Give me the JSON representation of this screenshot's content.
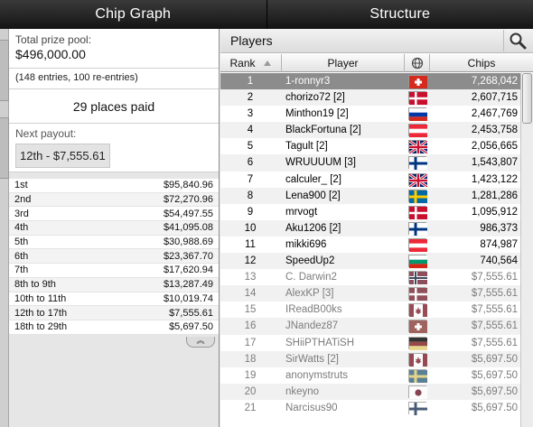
{
  "tabs": [
    "Chip Graph",
    "Structure"
  ],
  "prize": {
    "label": "Total prize pool:",
    "value": "$496,000.00",
    "entries": "(148 entries, 100 re-entries)",
    "places_paid": "29 places paid"
  },
  "next_payout": {
    "label": "Next payout:",
    "value": "12th - $7,555.61"
  },
  "payouts": [
    {
      "place": "1st",
      "amount": "$95,840.96"
    },
    {
      "place": "2nd",
      "amount": "$72,270.96"
    },
    {
      "place": "3rd",
      "amount": "$54,497.55"
    },
    {
      "place": "4th",
      "amount": "$41,095.08"
    },
    {
      "place": "5th",
      "amount": "$30,988.69"
    },
    {
      "place": "6th",
      "amount": "$23,367.70"
    },
    {
      "place": "7th",
      "amount": "$17,620.94"
    },
    {
      "place": "8th to 9th",
      "amount": "$13,287.49"
    },
    {
      "place": "10th to 11th",
      "amount": "$10,019.74"
    },
    {
      "place": "12th to 17th",
      "amount": "$7,555.61"
    },
    {
      "place": "18th to 29th",
      "amount": "$5,697.50"
    }
  ],
  "collapse_glyph": "︽",
  "players": {
    "title": "Players",
    "columns": {
      "rank": "Rank",
      "player": "Player",
      "chips": "Chips"
    },
    "rows": [
      {
        "rank": "1",
        "name": "1-ronnyr3",
        "flag": "ch",
        "chips": "7,268,042"
      },
      {
        "rank": "2",
        "name": "chorizo72 [2]",
        "flag": "dk",
        "chips": "2,607,715"
      },
      {
        "rank": "3",
        "name": "Minthon19 [2]",
        "flag": "ru",
        "chips": "2,467,769"
      },
      {
        "rank": "4",
        "name": "BlackFortuna [2]",
        "flag": "at",
        "chips": "2,453,758"
      },
      {
        "rank": "5",
        "name": "Tagult [2]",
        "flag": "gb",
        "chips": "2,056,665"
      },
      {
        "rank": "6",
        "name": "WRUUUUM [3]",
        "flag": "fi",
        "chips": "1,543,807"
      },
      {
        "rank": "7",
        "name": "calculer_ [2]",
        "flag": "gb",
        "chips": "1,423,122"
      },
      {
        "rank": "8",
        "name": "Lena900 [2]",
        "flag": "se",
        "chips": "1,281,286"
      },
      {
        "rank": "9",
        "name": "mrvogt",
        "flag": "dk",
        "chips": "1,095,912"
      },
      {
        "rank": "10",
        "name": "Aku1206 [2]",
        "flag": "fi",
        "chips": "986,373"
      },
      {
        "rank": "11",
        "name": "mikki696",
        "flag": "at",
        "chips": "874,987"
      },
      {
        "rank": "12",
        "name": "SpeedUp2",
        "flag": "bg",
        "chips": "740,564"
      },
      {
        "rank": "13",
        "name": "C. Darwin2",
        "flag": "no",
        "chips": "$7,555.61"
      },
      {
        "rank": "14",
        "name": "AlexKP [3]",
        "flag": "dk",
        "chips": "$7,555.61"
      },
      {
        "rank": "15",
        "name": "IReadB00ks",
        "flag": "ca",
        "chips": "$7,555.61"
      },
      {
        "rank": "16",
        "name": "JNandez87",
        "flag": "ch",
        "chips": "$7,555.61"
      },
      {
        "rank": "17",
        "name": "SHiiPTHATiSH",
        "flag": "de",
        "chips": "$7,555.61"
      },
      {
        "rank": "18",
        "name": "SirWatts [2]",
        "flag": "ca",
        "chips": "$5,697.50"
      },
      {
        "rank": "19",
        "name": "anonymstruts",
        "flag": "se",
        "chips": "$5,697.50"
      },
      {
        "rank": "20",
        "name": "nkeyno",
        "flag": "jp",
        "chips": "$5,697.50"
      },
      {
        "rank": "21",
        "name": "Narcisus90",
        "flag": "fi",
        "chips": "$5,697.50"
      }
    ]
  },
  "colors": {
    "selected_row": "#8c8c8c",
    "eliminated_text": "#7c7c7c",
    "tab_bg": "#1e1e1e"
  },
  "icons": {
    "search": "magnifier-icon",
    "globe": "globe-icon",
    "sort": "sort-asc-icon"
  }
}
